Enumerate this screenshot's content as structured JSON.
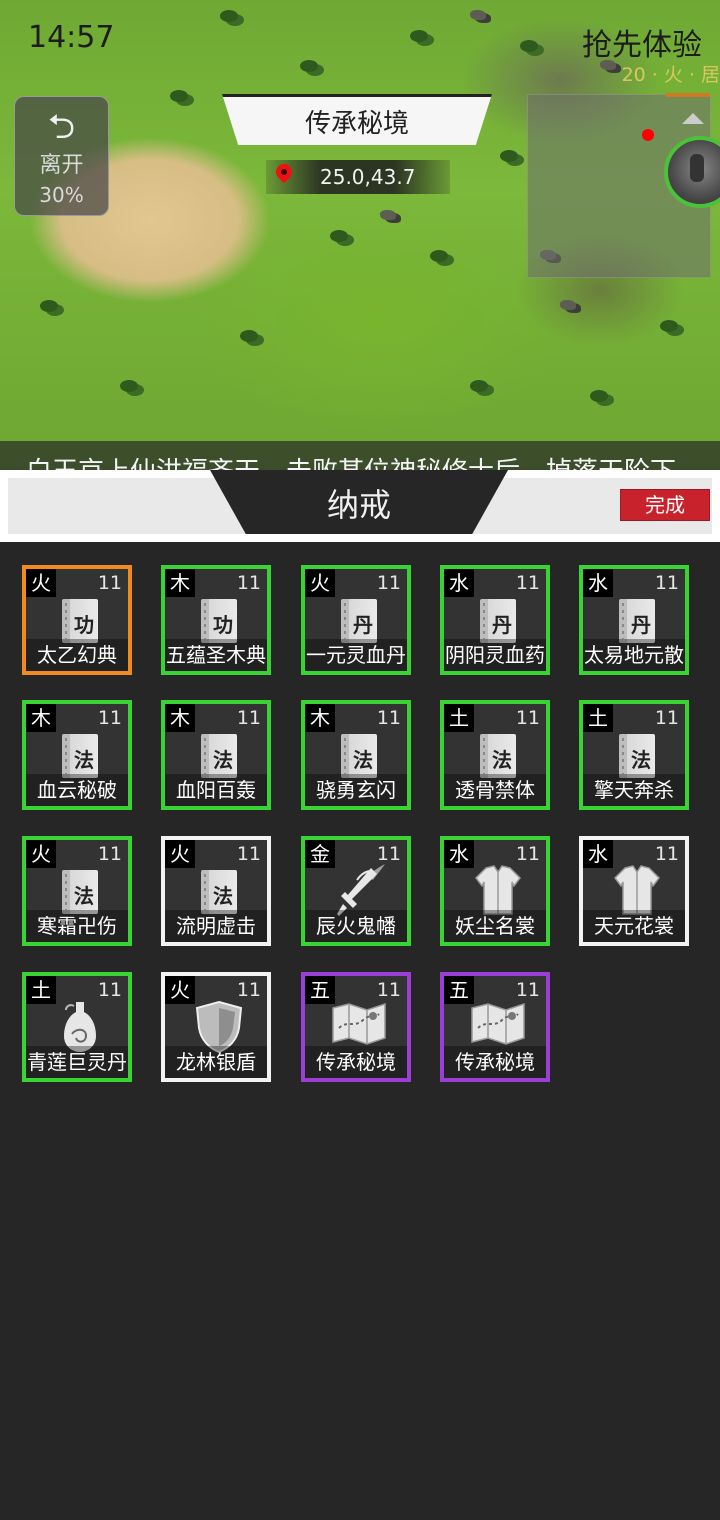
{
  "status": {
    "time": "14:57"
  },
  "event": {
    "title": "抢先体验",
    "subtitle": "20 · 火 · 居"
  },
  "leave": {
    "label": "离开",
    "percent": "30%"
  },
  "location": {
    "name": "传承秘境",
    "coords": "25.0,43.7"
  },
  "marquee": "白玉京上仙洪福齐天，击败某位神秘修士后，掉落天阶下",
  "bag": {
    "title": "纳戒",
    "done_label": "完成"
  },
  "items": [
    {
      "element": "火",
      "level": "11",
      "name": "太乙幻典",
      "icon": "book-gong-icon",
      "glyph": "功",
      "rarity": "orange"
    },
    {
      "element": "木",
      "level": "11",
      "name": "五蕴圣木典",
      "icon": "book-gong-icon",
      "glyph": "功",
      "rarity": "green"
    },
    {
      "element": "火",
      "level": "11",
      "name": "一元灵血丹",
      "icon": "book-dan-icon",
      "glyph": "丹",
      "rarity": "green"
    },
    {
      "element": "水",
      "level": "11",
      "name": "阴阳灵血药",
      "icon": "book-dan-icon",
      "glyph": "丹",
      "rarity": "green"
    },
    {
      "element": "水",
      "level": "11",
      "name": "太易地元散",
      "icon": "book-dan-icon",
      "glyph": "丹",
      "rarity": "green"
    },
    {
      "element": "木",
      "level": "11",
      "name": "血云秘破",
      "icon": "book-fa-icon",
      "glyph": "法",
      "rarity": "green"
    },
    {
      "element": "木",
      "level": "11",
      "name": "血阳百轰",
      "icon": "book-fa-icon",
      "glyph": "法",
      "rarity": "green"
    },
    {
      "element": "木",
      "level": "11",
      "name": "骁勇玄闪",
      "icon": "book-fa-icon",
      "glyph": "法",
      "rarity": "green"
    },
    {
      "element": "土",
      "level": "11",
      "name": "透骨禁体",
      "icon": "book-fa-icon",
      "glyph": "法",
      "rarity": "green"
    },
    {
      "element": "土",
      "level": "11",
      "name": "擎天奔杀",
      "icon": "book-fa-icon",
      "glyph": "法",
      "rarity": "green"
    },
    {
      "element": "火",
      "level": "11",
      "name": "寒霜卍伤",
      "icon": "book-fa-icon",
      "glyph": "法",
      "rarity": "green"
    },
    {
      "element": "火",
      "level": "11",
      "name": "流明虚击",
      "icon": "book-fa-icon",
      "glyph": "法",
      "rarity": "white"
    },
    {
      "element": "金",
      "level": "11",
      "name": "辰火鬼幡",
      "icon": "sword-icon",
      "glyph": "",
      "rarity": "green"
    },
    {
      "element": "水",
      "level": "11",
      "name": "妖尘名裳",
      "icon": "robe-icon",
      "glyph": "",
      "rarity": "green"
    },
    {
      "element": "水",
      "level": "11",
      "name": "天元花裳",
      "icon": "robe-icon",
      "glyph": "",
      "rarity": "white"
    },
    {
      "element": "土",
      "level": "11",
      "name": "青莲巨灵丹",
      "icon": "gourd-icon",
      "glyph": "",
      "rarity": "green"
    },
    {
      "element": "火",
      "level": "11",
      "name": "龙林银盾",
      "icon": "shield-icon",
      "glyph": "",
      "rarity": "white"
    },
    {
      "element": "五",
      "level": "11",
      "name": "传承秘境",
      "icon": "map-scroll-icon",
      "glyph": "",
      "rarity": "purple"
    },
    {
      "element": "五",
      "level": "11",
      "name": "传承秘境",
      "icon": "map-scroll-icon",
      "glyph": "",
      "rarity": "purple"
    }
  ],
  "colors": {
    "green": "#39d334",
    "orange": "#f28a1e",
    "white": "#f3f3f3",
    "purple": "#9b3ed3",
    "done": "#c8232d"
  }
}
